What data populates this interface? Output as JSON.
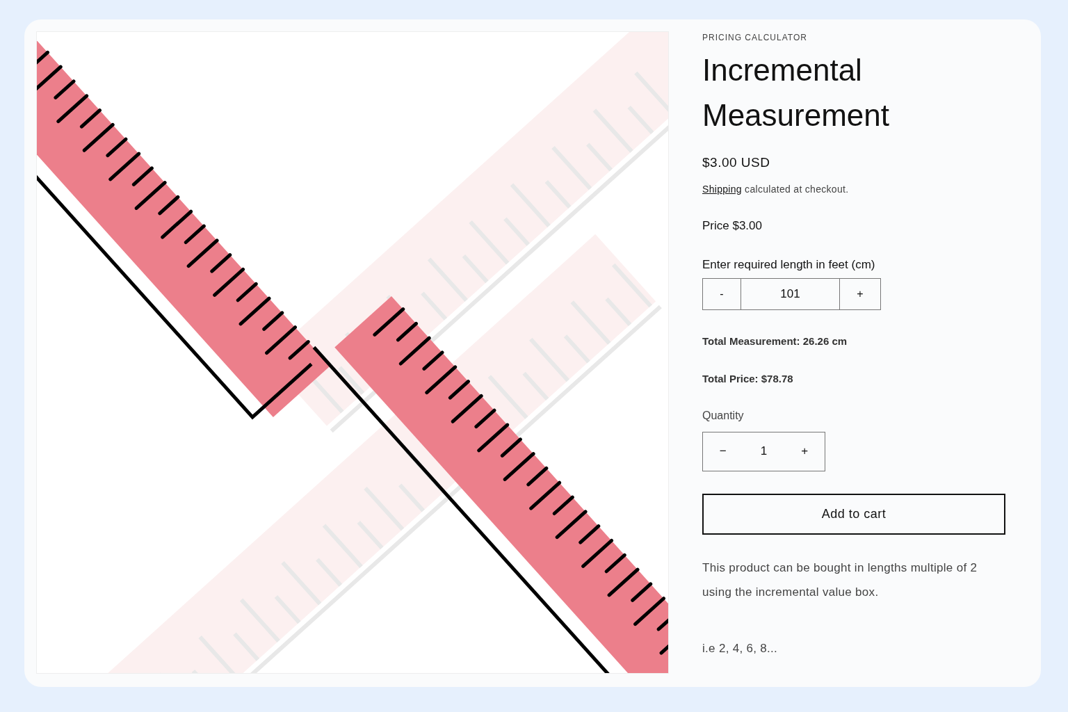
{
  "eyebrow": "PRICING CALCULATOR",
  "title": "Incremental Measurement",
  "price": "$3.00 USD",
  "shipping": {
    "link": "Shipping",
    "text": "calculated at checkout."
  },
  "unit_price": "Price $3.00",
  "length": {
    "label": "Enter required length in feet (cm)",
    "decrement": "-",
    "value": "101",
    "increment": "+"
  },
  "total_measurement": "Total Measurement: 26.26 cm",
  "total_price": "Total Price: $78.78",
  "quantity": {
    "label": "Quantity",
    "decrement": "−",
    "value": "1",
    "increment": "+"
  },
  "add_to_cart": "Add to cart",
  "description": [
    "This product can be bought in lengths multiple of 2 using the incremental value box.",
    "i.e 2, 4, 6, 8..."
  ]
}
